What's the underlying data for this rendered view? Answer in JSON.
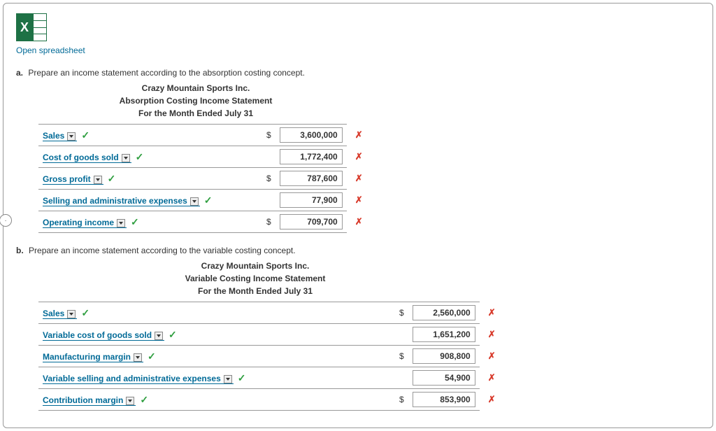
{
  "excel_letter": "X",
  "open_link": "Open spreadsheet",
  "prompt_a_letter": "a.",
  "prompt_a_text": "Prepare an income statement according to the absorption costing concept.",
  "prompt_b_letter": "b.",
  "prompt_b_text": "Prepare an income statement according to the variable costing concept.",
  "company": "Crazy Mountain Sports Inc.",
  "stmt_a": {
    "title": "Absorption Costing Income Statement",
    "period": "For the Month Ended July 31",
    "rows": [
      {
        "label": "Sales",
        "dollar": "$",
        "value": "3,600,000"
      },
      {
        "label": "Cost of goods sold",
        "dollar": "",
        "value": "1,772,400"
      },
      {
        "label": "Gross profit",
        "dollar": "$",
        "value": "787,600"
      },
      {
        "label": "Selling and administrative expenses",
        "dollar": "",
        "value": "77,900"
      },
      {
        "label": "Operating income",
        "dollar": "$",
        "value": "709,700"
      }
    ]
  },
  "stmt_b": {
    "title": "Variable Costing Income Statement",
    "period": "For the Month Ended July 31",
    "rows": [
      {
        "label": "Sales",
        "dollar": "$",
        "value": "2,560,000"
      },
      {
        "label": "Variable cost of goods sold",
        "dollar": "",
        "value": "1,651,200"
      },
      {
        "label": "Manufacturing margin",
        "dollar": "$",
        "value": "908,800"
      },
      {
        "label": "Variable selling and administrative expenses",
        "dollar": "",
        "value": "54,900"
      },
      {
        "label": "Contribution margin",
        "dollar": "$",
        "value": "853,900"
      }
    ]
  },
  "marks": {
    "check": "✓",
    "cross": "✗"
  }
}
